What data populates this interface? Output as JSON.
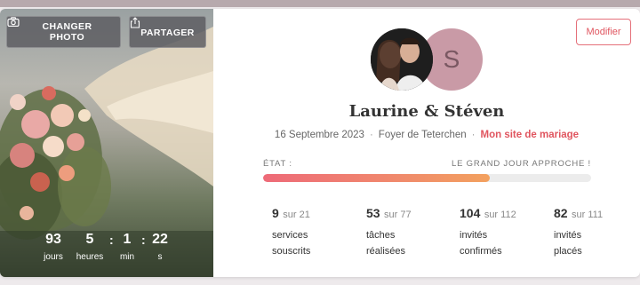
{
  "photo_panel": {
    "change_photo_label": "CHANGER PHOTO",
    "share_label": "PARTAGER",
    "countdown": [
      {
        "value": "93",
        "label": "jours"
      },
      {
        "value": "5",
        "label": "heures"
      },
      {
        "value": "1",
        "label": "min"
      },
      {
        "value": "22",
        "label": "s"
      }
    ]
  },
  "profile": {
    "modify_label": "Modifier",
    "partner_initial": "S",
    "couple_names": "Laurine & Stéven",
    "wedding_date": "16 Septembre 2023",
    "location": "Foyer de Teterchen",
    "site_link": "Mon site de mariage",
    "status_label": "ÉTAT :",
    "status_message": "LE GRAND JOUR APPROCHE !",
    "progress_fraction": 0.69
  },
  "stats": [
    {
      "value": "9",
      "of": "sur 21",
      "line1": "services",
      "line2": "souscrits"
    },
    {
      "value": "53",
      "of": "sur 77",
      "line1": "tâches",
      "line2": "réalisées"
    },
    {
      "value": "104",
      "of": "sur 112",
      "line1": "invités",
      "line2": "confirmés"
    },
    {
      "value": "82",
      "of": "sur 111",
      "line1": "invités",
      "line2": "placés"
    }
  ],
  "colors": {
    "accent": "#e0555f",
    "avatar_bg": "#c99aa6"
  }
}
